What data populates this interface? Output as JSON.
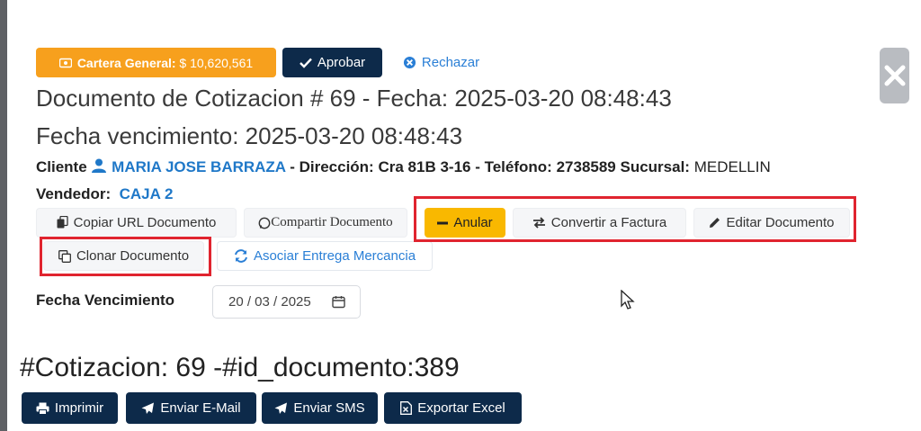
{
  "top_actions": {
    "cartera_label": "Cartera General:",
    "cartera_value": "$ 10,620,561",
    "approve_label": "Aprobar",
    "reject_label": "Rechazar"
  },
  "header": {
    "title_line1": "Documento de Cotizacion # 69 - Fecha: 2025-03-20 08:48:43",
    "title_line2": "Fecha vencimiento: 2025-03-20 08:48:43"
  },
  "client": {
    "cliente_label": "Cliente",
    "cliente_name": "MARIA JOSE BARRAZA",
    "direccion_label": "- Dirección:",
    "direccion_value": "Cra 81B 3-16",
    "telefono_label": "- Teléfono:",
    "telefono_value": "2738589",
    "sucursal_label": "Sucursal:",
    "sucursal_value": "MEDELLIN",
    "vendedor_label": "Vendedor:",
    "vendedor_value": "CAJA 2"
  },
  "doc_actions": {
    "copy_url": "Copiar URL Documento",
    "share": "Compartir Documento",
    "anular": "Anular",
    "convertir": "Convertir a Factura",
    "editar": "Editar Documento",
    "clonar": "Clonar Documento",
    "asociar": "Asociar Entrega Mercancia"
  },
  "due_date": {
    "label": "Fecha Vencimiento",
    "value": "20 / 03 / 2025"
  },
  "document": {
    "title": "#Cotizacion: 69 -#id_documento:389"
  },
  "export_actions": {
    "print": "Imprimir",
    "email": "Enviar E-Mail",
    "sms": "Enviar SMS",
    "excel": "Exportar Excel"
  },
  "colors": {
    "accent_orange": "#f7a01d",
    "navy": "#0d2a4a",
    "link_blue": "#1f78c8",
    "warning_yellow": "#f9b800",
    "highlight_red": "#e0242f"
  }
}
